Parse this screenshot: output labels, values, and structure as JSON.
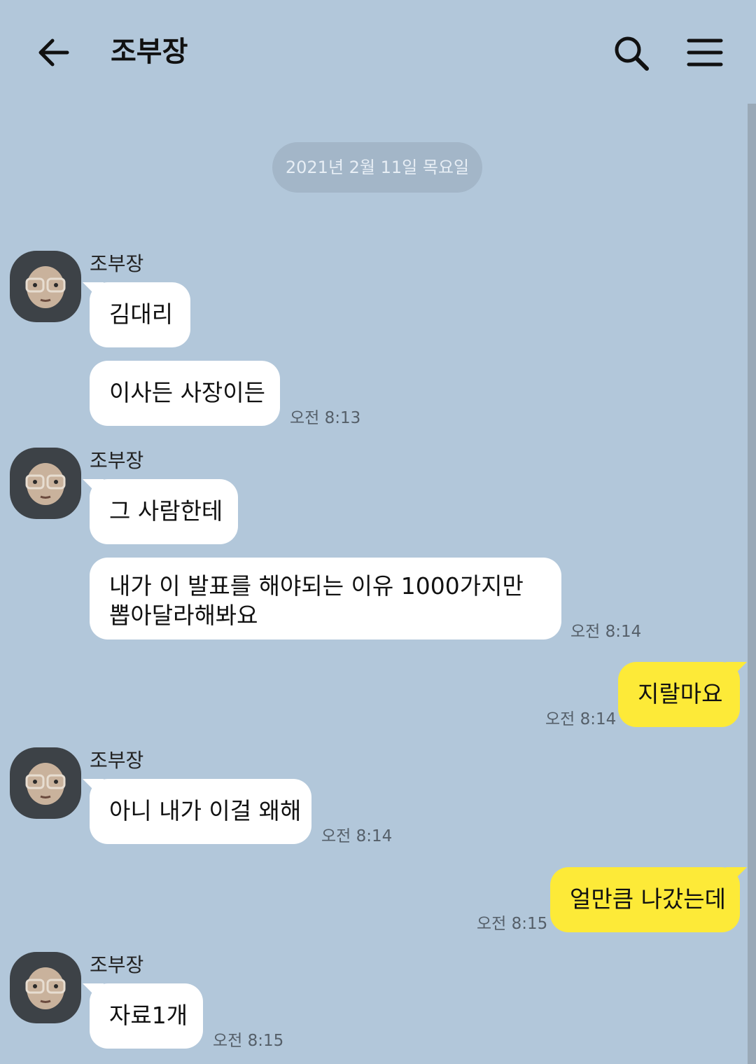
{
  "header": {
    "title": "조부장",
    "back_icon": "arrow-left-icon",
    "search_icon": "search-icon",
    "menu_icon": "hamburger-menu-icon"
  },
  "date_divider": "2021년 2월 11일 목요일",
  "messages": [
    {
      "sender": "조부장",
      "text": "김대리"
    },
    {
      "text": "이사든 사장이든",
      "time": "오전 8:13"
    },
    {
      "sender": "조부장",
      "text": "그 사람한테"
    },
    {
      "line1": "내가 이 발표를 해야되는 이유 1000가지만",
      "line2": "뽑아달라해봐요",
      "time": "오전 8:14"
    },
    {
      "text": "지랄마요",
      "time": "오전 8:14",
      "mine": true
    },
    {
      "sender": "조부장",
      "text": "아니 내가 이걸 왜해",
      "time": "오전 8:14"
    },
    {
      "text": "얼만큼 나갔는데",
      "time": "오전 8:15",
      "mine": true
    },
    {
      "sender": "조부장",
      "text": "자료1개",
      "time": "오전 8:15"
    }
  ],
  "colors": {
    "background": "#b2c7da",
    "incoming_bubble": "#ffffff",
    "outgoing_bubble": "#fdea38",
    "date_pill": "#a3b6c8"
  }
}
